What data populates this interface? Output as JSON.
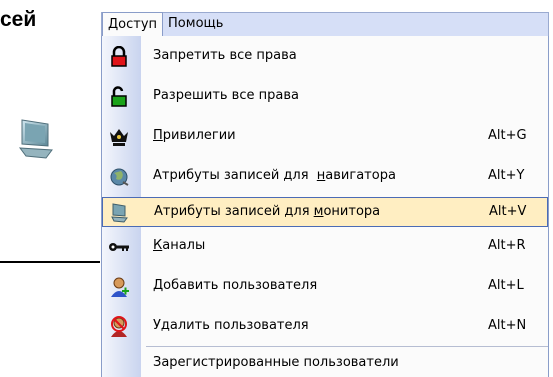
{
  "background": {
    "title_fragment": "сей"
  },
  "menubar": {
    "items": [
      {
        "label": "Доступ",
        "active": true
      },
      {
        "label": "Помощь",
        "active": false
      }
    ]
  },
  "menu": {
    "highlighted_index": 4,
    "items": [
      {
        "label": "Запретить все права",
        "shortcut": "",
        "icon": "red-padlock-icon"
      },
      {
        "label": "Разрешить все права",
        "shortcut": "",
        "icon": "green-open-padlock-icon"
      },
      {
        "label_pre": "",
        "label_u": "П",
        "label_post": "ривилегии",
        "shortcut": "Alt+G",
        "icon": "crown-privileges-icon"
      },
      {
        "label_pre": "Атрибуты записей для  ",
        "label_u": "н",
        "label_post": "авигатора",
        "shortcut": "Alt+Y",
        "icon": "globe-navigator-icon"
      },
      {
        "label_pre": "Атрибуты записей для ",
        "label_u": "м",
        "label_post": "онитора",
        "shortcut": "Alt+V",
        "icon": "monitor-icon"
      },
      {
        "label_pre": "",
        "label_u": "К",
        "label_post": "аналы",
        "shortcut": "Alt+R",
        "icon": "key-channels-icon"
      },
      {
        "label": "Добавить пользователя",
        "shortcut": "Alt+L",
        "icon": "add-user-icon"
      },
      {
        "label": "Удалить пользователя",
        "shortcut": "Alt+N",
        "icon": "delete-user-icon"
      },
      {
        "label": "Зарегистрированные пользователи",
        "shortcut": "",
        "icon": ""
      }
    ]
  },
  "colors": {
    "menubar_bg": "#d6dff7",
    "menu_bg": "#fbfbfb",
    "highlight_bg": "#ffeec2",
    "highlight_border": "#4b6bb5"
  }
}
